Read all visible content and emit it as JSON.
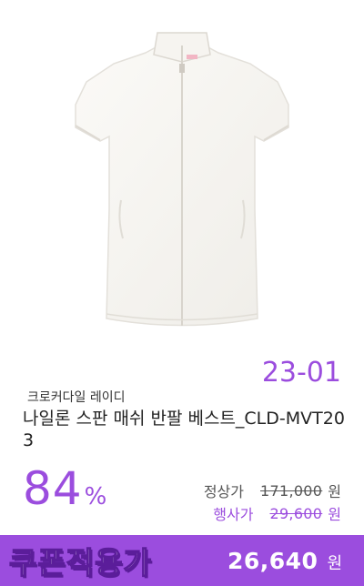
{
  "product": {
    "code_tag": "23-01",
    "brand": "크로커다일 레이디",
    "title": "나일론 스판 매쉬 반팔 베스트_CLD-MVT203",
    "image_icon": "white-short-sleeve-zip-vest"
  },
  "discount": {
    "value": "84",
    "unit": "%"
  },
  "prices": {
    "regular_label": "정상가",
    "regular_value": "171,000",
    "regular_unit": "원",
    "event_label": "행사가",
    "event_value": "29,600",
    "event_unit": "원"
  },
  "coupon": {
    "label": "쿠폰적용가",
    "value": "26,640",
    "unit": "원"
  },
  "colors": {
    "accent": "#9b4dde",
    "accent_dark": "#5b1d9a"
  }
}
